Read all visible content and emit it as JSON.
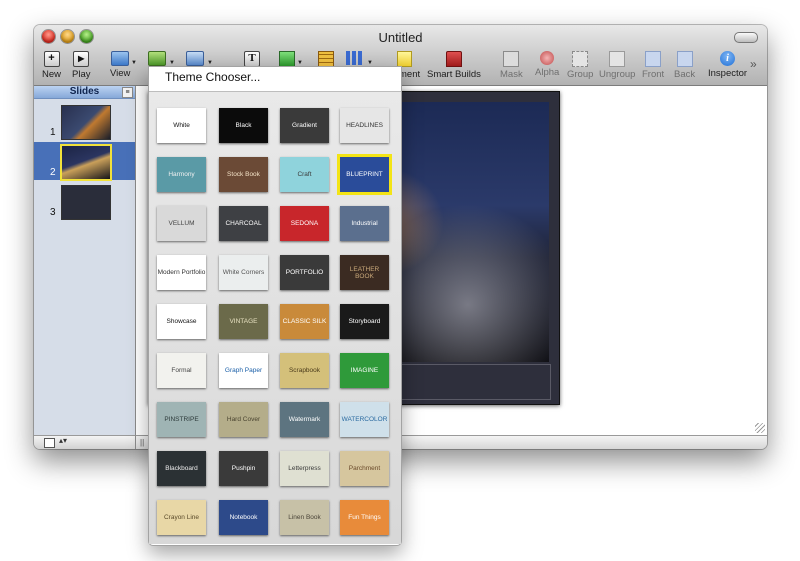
{
  "window": {
    "title": "Untitled"
  },
  "toolbar": {
    "new_label": "New",
    "play_label": "Play",
    "view_label": "View",
    "text_glyph": "T",
    "comment_label": "ment",
    "smart_builds_label": "Smart Builds",
    "mask_label": "Mask",
    "alpha_label": "Alpha",
    "group_label": "Group",
    "ungroup_label": "Ungroup",
    "front_label": "Front",
    "back_label": "Back",
    "inspector_label": "Inspector",
    "overflow_glyph": "»"
  },
  "sidebar": {
    "title": "Slides",
    "slides": [
      {
        "number": "1"
      },
      {
        "number": "2"
      },
      {
        "number": "3"
      }
    ]
  },
  "theme_menu": {
    "title": "Theme Chooser...",
    "themes": [
      {
        "name": "White",
        "bg": "#ffffff",
        "fg": "#111111"
      },
      {
        "name": "Black",
        "bg": "#0b0b0b",
        "fg": "#ffffff"
      },
      {
        "name": "Gradient",
        "bg": "#3a3a3a",
        "fg": "#ffffff"
      },
      {
        "name": "HEADLINES",
        "bg": "#e6e6e6",
        "fg": "#333333"
      },
      {
        "name": "Harmony",
        "bg": "#5a9aa6",
        "fg": "#f0f0f0"
      },
      {
        "name": "Stock Book",
        "bg": "#6b4a36",
        "fg": "#f3e2c7"
      },
      {
        "name": "Craft",
        "bg": "#8fd3dc",
        "fg": "#3b3b3b"
      },
      {
        "name": "BLUEPRINT",
        "bg": "#2a4c9a",
        "fg": "#ffffff"
      },
      {
        "name": "VELLUM",
        "bg": "#d9d9d9",
        "fg": "#444444"
      },
      {
        "name": "CHARCOAL",
        "bg": "#3e4044",
        "fg": "#ffffff"
      },
      {
        "name": "SEDONA",
        "bg": "#c8262b",
        "fg": "#ffffff"
      },
      {
        "name": "Industrial",
        "bg": "#5b6f8e",
        "fg": "#ffffff"
      },
      {
        "name": "Modern Portfolio",
        "bg": "#ffffff",
        "fg": "#333333"
      },
      {
        "name": "White Corners",
        "bg": "#ebeeee",
        "fg": "#555555"
      },
      {
        "name": "PORTFOLIO",
        "bg": "#3a3a3a",
        "fg": "#ffffff"
      },
      {
        "name": "LEATHER BOOK",
        "bg": "#3b2b22",
        "fg": "#c9a87a"
      },
      {
        "name": "Showcase",
        "bg": "#ffffff",
        "fg": "#111111"
      },
      {
        "name": "VINTAGE",
        "bg": "#6b6a4a",
        "fg": "#e8e2c2"
      },
      {
        "name": "CLASSIC SILK",
        "bg": "#c98a3a",
        "fg": "#ffffff"
      },
      {
        "name": "Storyboard",
        "bg": "#1a1a1a",
        "fg": "#ffffff"
      },
      {
        "name": "Formal",
        "bg": "#f2f2ee",
        "fg": "#444444"
      },
      {
        "name": "Graph Paper",
        "bg": "#ffffff",
        "fg": "#1a5fa8"
      },
      {
        "name": "Scrapbook",
        "bg": "#d4c07a",
        "fg": "#4a3a1a"
      },
      {
        "name": "IMAGINE",
        "bg": "#2f9a3a",
        "fg": "#ffffff"
      },
      {
        "name": "PINSTRIPE",
        "bg": "#9fb4b4",
        "fg": "#2d3a3a"
      },
      {
        "name": "Hard Cover",
        "bg": "#b4ad8a",
        "fg": "#4a4430"
      },
      {
        "name": "Watermark",
        "bg": "#5d7480",
        "fg": "#ffffff"
      },
      {
        "name": "WATERCOLOR",
        "bg": "#cfe0ea",
        "fg": "#2a6aa0"
      },
      {
        "name": "Blackboard",
        "bg": "#2b3134",
        "fg": "#f0f0f0"
      },
      {
        "name": "Pushpin",
        "bg": "#3a3a3a",
        "fg": "#ffffff"
      },
      {
        "name": "Letterpress",
        "bg": "#dfe0d2",
        "fg": "#3a3a3a"
      },
      {
        "name": "Parchment",
        "bg": "#d6c69e",
        "fg": "#6a4a2a"
      },
      {
        "name": "Crayon Line",
        "bg": "#e8d7a6",
        "fg": "#5a4a2a"
      },
      {
        "name": "Notebook",
        "bg": "#2d4a8a",
        "fg": "#ffffff"
      },
      {
        "name": "Linen Book",
        "bg": "#c7c1a7",
        "fg": "#4a4438"
      },
      {
        "name": "Fun Things",
        "bg": "#e88b3a",
        "fg": "#ffffff"
      }
    ]
  },
  "colors": {
    "selection_blue": "#4870b8",
    "selected_outline": "#f3e416",
    "inspector_blue": "#1f6fd6"
  }
}
